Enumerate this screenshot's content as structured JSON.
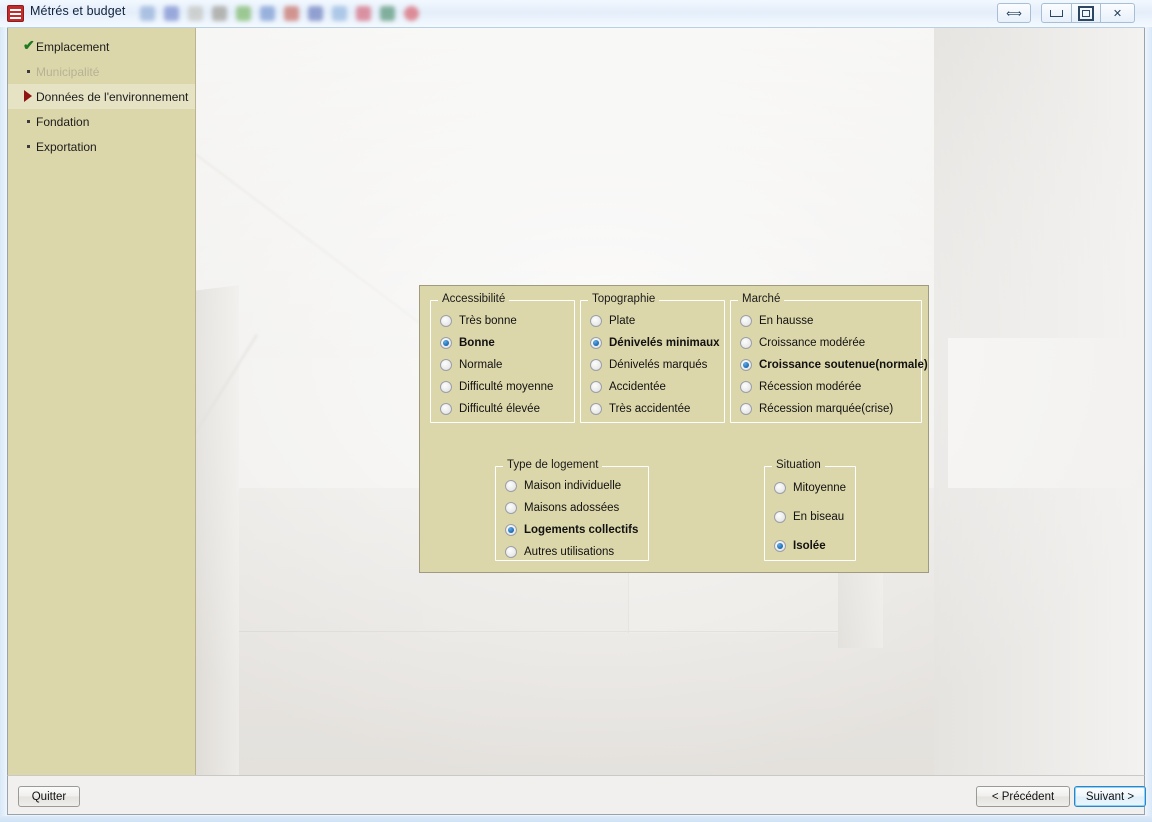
{
  "window": {
    "title": "Métrés et budget",
    "icon": "app-icon",
    "controls": {
      "restore_dual": "⟺",
      "minimize": "minimize-icon",
      "maximize": "maximize-icon",
      "close": "✕"
    }
  },
  "sidebar": {
    "items": [
      {
        "label": "Emplacement",
        "marker": "check",
        "state": "done"
      },
      {
        "label": "Municipalité",
        "marker": "bullet",
        "state": "disabled"
      },
      {
        "label": "Données de l'environnement",
        "marker": "arrow",
        "state": "current"
      },
      {
        "label": "Fondation",
        "marker": "bullet",
        "state": "normal"
      },
      {
        "label": "Exportation",
        "marker": "bullet",
        "state": "normal"
      }
    ]
  },
  "panel": {
    "groups": [
      {
        "key": "accessibilite",
        "legend": "Accessibilité",
        "options": [
          {
            "label": "Très bonne",
            "selected": false
          },
          {
            "label": "Bonne",
            "selected": true
          },
          {
            "label": "Normale",
            "selected": false
          },
          {
            "label": "Difficulté moyenne",
            "selected": false
          },
          {
            "label": "Difficulté élevée",
            "selected": false
          }
        ]
      },
      {
        "key": "topographie",
        "legend": "Topographie",
        "options": [
          {
            "label": "Plate",
            "selected": false
          },
          {
            "label": "Dénivelés minimaux",
            "selected": true
          },
          {
            "label": "Dénivelés marqués",
            "selected": false
          },
          {
            "label": "Accidentée",
            "selected": false
          },
          {
            "label": "Très accidentée",
            "selected": false
          }
        ]
      },
      {
        "key": "marche",
        "legend": "Marché",
        "options": [
          {
            "label": "En hausse",
            "selected": false
          },
          {
            "label": "Croissance modérée",
            "selected": false
          },
          {
            "label": "Croissance soutenue(normale)",
            "selected": true
          },
          {
            "label": "Récession modérée",
            "selected": false
          },
          {
            "label": "Récession marquée(crise)",
            "selected": false
          }
        ]
      },
      {
        "key": "type_de_logement",
        "legend": "Type de logement",
        "options": [
          {
            "label": "Maison individuelle",
            "selected": false
          },
          {
            "label": "Maisons adossées",
            "selected": false
          },
          {
            "label": "Logements collectifs",
            "selected": true
          },
          {
            "label": "Autres utilisations",
            "selected": false
          }
        ]
      },
      {
        "key": "situation",
        "legend": "Situation",
        "options": [
          {
            "label": "Mitoyenne",
            "selected": false
          },
          {
            "label": "En biseau",
            "selected": false
          },
          {
            "label": "Isolée",
            "selected": true
          }
        ]
      }
    ]
  },
  "commandbar": {
    "quit": "Quitter",
    "previous": "< Précédent",
    "next": "Suivant >"
  },
  "colors": {
    "sidebar_bg": "#dcd7ab",
    "sidebar_current_bg": "#e6e3c4",
    "panel_bg": "#dcd7ab",
    "radio_accent": "#1567ad",
    "check_green": "#1f7a1f",
    "arrow_red": "#8f1414",
    "next_focus_blue": "#2b86c9"
  }
}
